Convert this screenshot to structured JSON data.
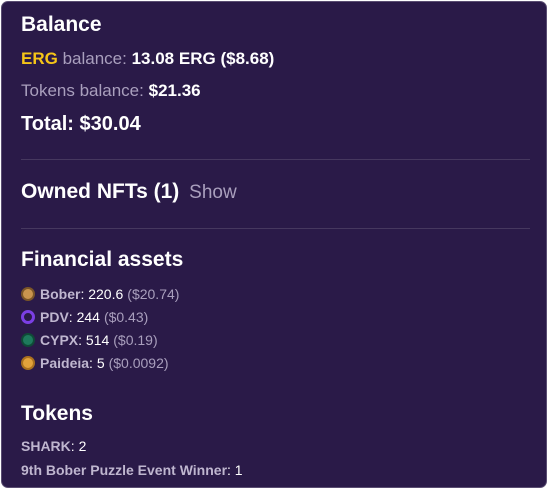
{
  "balance": {
    "title": "Balance",
    "erg_label": "ERG",
    "erg_balance_word": "balance:",
    "erg_amount": "13.08",
    "erg_unit": "ERG",
    "erg_usd": "($8.68)",
    "tokens_label": "Tokens balance:",
    "tokens_value": "$21.36",
    "total_label": "Total:",
    "total_value": "$30.04"
  },
  "nfts": {
    "title": "Owned NFTs",
    "count": "(1)",
    "show_label": "Show"
  },
  "financial_assets": {
    "title": "Financial assets",
    "items": [
      {
        "name": "Bober",
        "amount": "220.6",
        "usd": "($20.74)",
        "icon": "bober-icon",
        "color": "#c8944e"
      },
      {
        "name": "PDV",
        "amount": "244",
        "usd": "($0.43)",
        "icon": "pdv-icon",
        "color": "#7b3fe4"
      },
      {
        "name": "CYPX",
        "amount": "514",
        "usd": "($0.19)",
        "icon": "cypx-icon",
        "color": "#1e7a5c"
      },
      {
        "name": "Paideia",
        "amount": "5",
        "usd": "($0.0092)",
        "icon": "paideia-icon",
        "color": "#e2a23b"
      }
    ]
  },
  "tokens": {
    "title": "Tokens",
    "items": [
      {
        "name": "SHARK",
        "amount": "2"
      },
      {
        "name": "9th Bober Puzzle Event Winner",
        "amount": "1"
      }
    ]
  },
  "colors": {
    "background": "#2a1a48",
    "accent_erg": "#f5c518",
    "muted_text": "#a99fbd"
  }
}
